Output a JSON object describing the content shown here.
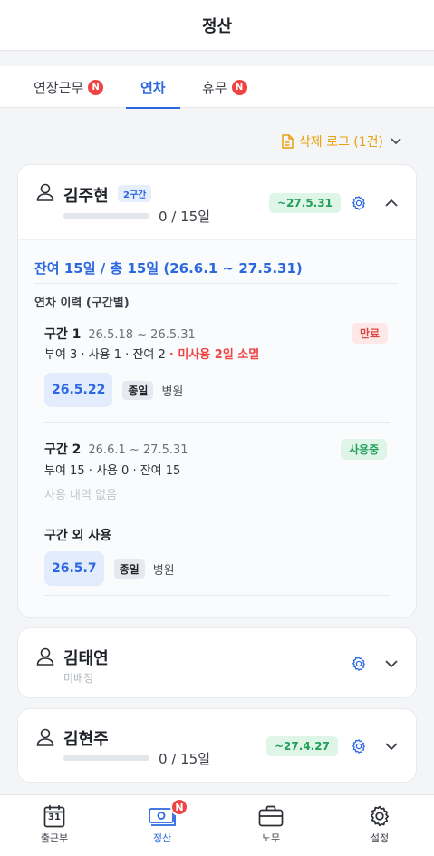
{
  "header": {
    "title": "정산"
  },
  "tabs": [
    {
      "label": "연장근무",
      "badge": "N"
    },
    {
      "label": "연차",
      "active": true
    },
    {
      "label": "휴무",
      "badge": "N"
    }
  ],
  "deleted_log": {
    "label": "삭제 로그 (1건)"
  },
  "employees": [
    {
      "name": "김주현",
      "segment_badge": "2구간",
      "ratio": "0 / 15일",
      "used_fraction": 0,
      "expiry": "~27.5.31",
      "expanded": true,
      "summary": "잔여 15일 / 총 15일 (26.6.1 ~ 27.5.31)",
      "history_title": "연차 이력 (구간별)",
      "segments": [
        {
          "title": "구간 1",
          "range": "26.5.18 ~ 26.5.31",
          "stats": "부여 3 · 사용 1 · 잔여 2",
          "warning": "· 미사용 2일 소멸",
          "status": "만료",
          "usage": [
            {
              "date": "26.5.22",
              "type": "종일",
              "place": "병원"
            }
          ]
        },
        {
          "title": "구간 2",
          "range": "26.6.1 ~ 27.5.31",
          "stats": "부여 15 · 사용 0 · 잔여 15",
          "status": "사용중",
          "no_usage": "사용 내역 없음"
        }
      ],
      "outside": {
        "title": "구간 외 사용",
        "usage": [
          {
            "date": "26.5.7",
            "type": "종일",
            "place": "병원"
          }
        ]
      }
    },
    {
      "name": "김태연",
      "sub": "미배정",
      "expanded": false
    },
    {
      "name": "김현주",
      "ratio": "0 / 15일",
      "used_fraction": 0,
      "expiry": "~27.4.27",
      "expanded": false
    }
  ],
  "bottom_nav": [
    {
      "label": "출근부",
      "icon": "calendar-icon",
      "calendar_day": "31"
    },
    {
      "label": "정산",
      "icon": "money-icon",
      "badge": "N",
      "active": true
    },
    {
      "label": "노무",
      "icon": "briefcase-icon"
    },
    {
      "label": "설정",
      "icon": "gear-icon"
    }
  ],
  "colors": {
    "accent": "#2a67e0",
    "warn": "#ef4444",
    "gold": "#e8a10a",
    "green": "#22a05a"
  }
}
